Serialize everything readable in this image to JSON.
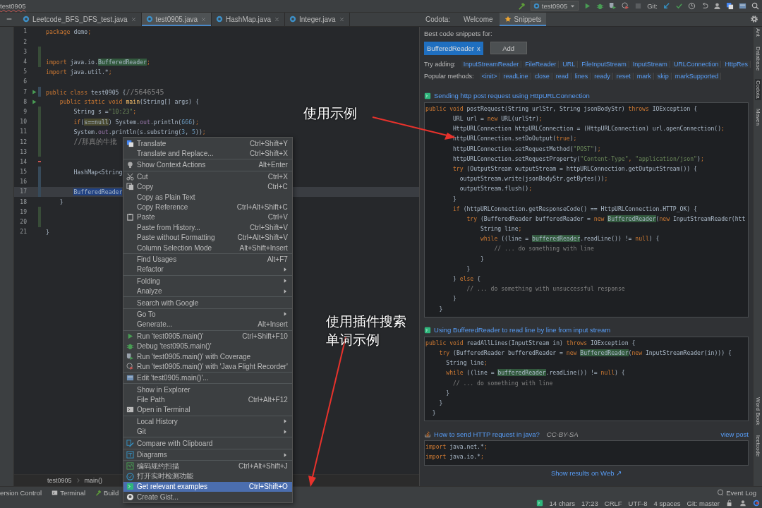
{
  "title_bar": {
    "breadcrumb": "test0905",
    "run_config": "test0905",
    "vcs_label": "Git:"
  },
  "editor_tabs": [
    {
      "label": "Leetcode_BFS_DFS_test.java",
      "selected": false
    },
    {
      "label": "test0905.java",
      "selected": true
    },
    {
      "label": "HashMap.java",
      "selected": false
    },
    {
      "label": "Integer.java",
      "selected": false
    }
  ],
  "tool_window": {
    "label": "Codota:",
    "tabs": [
      {
        "label": "Welcome",
        "selected": false
      },
      {
        "label": "Snippets",
        "selected": true
      }
    ]
  },
  "editor": {
    "lines": [
      {
        "number": "1",
        "kind": "plain",
        "runnable": false,
        "current": false,
        "segments": [
          {
            "text": "package",
            "kind": "keyword"
          },
          {
            "text": " demo",
            "kind": "plain"
          },
          {
            "text": ";",
            "kind": "keyword"
          }
        ]
      },
      {
        "number": "2",
        "kind": "plain",
        "runnable": false,
        "current": false
      },
      {
        "number": "3",
        "kind": "added",
        "runnable": false,
        "current": false
      },
      {
        "number": "4",
        "kind": "added",
        "runnable": false,
        "current": false,
        "segments": [
          {
            "text": "import",
            "kind": "keyword"
          },
          {
            "text": " java.io.",
            "kind": "plain"
          },
          {
            "text": "BufferedReader",
            "kind": "match"
          },
          {
            "text": ";",
            "kind": "keyword"
          }
        ]
      },
      {
        "number": "5",
        "kind": "plain",
        "runnable": false,
        "current": false,
        "segments": [
          {
            "text": "import",
            "kind": "keyword"
          },
          {
            "text": " java.util.*",
            "kind": "plain"
          },
          {
            "text": ";",
            "kind": "keyword"
          }
        ]
      },
      {
        "number": "6",
        "kind": "plain",
        "runnable": false,
        "current": false
      },
      {
        "number": "7",
        "kind": "modified",
        "runnable": true,
        "current": false,
        "segments": [
          {
            "text": "public class",
            "kind": "keyword"
          },
          {
            "text": " test0905 {",
            "kind": "plain"
          },
          {
            "text": "//5646545",
            "kind": "comment"
          }
        ]
      },
      {
        "number": "8",
        "kind": "plain",
        "runnable": true,
        "current": false,
        "segments": [
          {
            "text": "    public static void ",
            "kind": "keyword"
          },
          {
            "text": "main",
            "kind": "method"
          },
          {
            "text": "(String[] args) {",
            "kind": "plain"
          }
        ]
      },
      {
        "number": "9",
        "kind": "added",
        "runnable": false,
        "current": false,
        "segments": [
          {
            "text": "        String s =",
            "kind": "plain"
          },
          {
            "text": "\"10:23\"",
            "kind": "string"
          },
          {
            "text": ";",
            "kind": "keyword"
          }
        ]
      },
      {
        "number": "10",
        "kind": "added",
        "runnable": false,
        "current": false,
        "segments": [
          {
            "text": "        if",
            "kind": "keyword"
          },
          {
            "text": "(",
            "kind": "plain"
          },
          {
            "text": "s==null",
            "kind": "usage"
          },
          {
            "text": ") System.",
            "kind": "plain"
          },
          {
            "text": "out",
            "kind": "field"
          },
          {
            "text": ".println(",
            "kind": "plain"
          },
          {
            "text": "666",
            "kind": "number"
          },
          {
            "text": ")",
            "kind": "plain"
          },
          {
            "text": ";",
            "kind": "keyword"
          }
        ]
      },
      {
        "number": "11",
        "kind": "added",
        "runnable": false,
        "current": false,
        "segments": [
          {
            "text": "        System.",
            "kind": "plain"
          },
          {
            "text": "out",
            "kind": "field"
          },
          {
            "text": ".println(s.substring(",
            "kind": "plain"
          },
          {
            "text": "3",
            "kind": "number"
          },
          {
            "text": ", ",
            "kind": "plain"
          },
          {
            "text": "5",
            "kind": "number"
          },
          {
            "text": "))",
            "kind": "plain"
          },
          {
            "text": ";",
            "kind": "keyword"
          }
        ]
      },
      {
        "number": "12",
        "kind": "added",
        "runnable": false,
        "current": false,
        "segments": [
          {
            "text": "        //那真的牛批",
            "kind": "comment"
          }
        ]
      },
      {
        "number": "13",
        "kind": "added",
        "runnable": false,
        "current": false
      },
      {
        "number": "14",
        "kind": "deleted",
        "runnable": false,
        "current": false
      },
      {
        "number": "15",
        "kind": "modified",
        "runnable": false,
        "current": false,
        "segments": [
          {
            "text": "        HashMap<String",
            "kind": "plain"
          }
        ]
      },
      {
        "number": "16",
        "kind": "modified",
        "runnable": false,
        "current": false
      },
      {
        "number": "17",
        "kind": "modified",
        "runnable": false,
        "current": true,
        "segments": [
          {
            "text": "        BufferedReader",
            "kind": "selection"
          }
        ]
      },
      {
        "number": "18",
        "kind": "plain",
        "runnable": false,
        "current": false,
        "segments": [
          {
            "text": "    }",
            "kind": "plain"
          }
        ]
      },
      {
        "number": "19",
        "kind": "added",
        "runnable": false,
        "current": false
      },
      {
        "number": "20",
        "kind": "added",
        "runnable": false,
        "current": false
      },
      {
        "number": "21",
        "kind": "plain",
        "runnable": false,
        "current": false,
        "segments": [
          {
            "text": "}",
            "kind": "plain"
          }
        ]
      }
    ],
    "breadcrumb": [
      "test0905",
      "main()"
    ]
  },
  "context_menu": {
    "groups": [
      [
        {
          "label": "Translate",
          "shortcut": "Ctrl+Shift+Y",
          "submenu": false,
          "selected": false
        },
        {
          "label": "Translate and Replace...",
          "shortcut": "Ctrl+Shift+X",
          "submenu": false,
          "selected": false
        }
      ],
      [
        {
          "label": "Show Context Actions",
          "shortcut": "Alt+Enter",
          "submenu": false,
          "selected": false
        }
      ],
      [
        {
          "label": "Cut",
          "shortcut": "Ctrl+X",
          "submenu": false,
          "selected": false
        },
        {
          "label": "Copy",
          "shortcut": "Ctrl+C",
          "submenu": false,
          "selected": false
        },
        {
          "label": "Copy as Plain Text",
          "submenu": false,
          "selected": false
        },
        {
          "label": "Copy Reference",
          "shortcut": "Ctrl+Alt+Shift+C",
          "submenu": false,
          "selected": false
        },
        {
          "label": "Paste",
          "shortcut": "Ctrl+V",
          "submenu": false,
          "selected": false
        },
        {
          "label": "Paste from History...",
          "shortcut": "Ctrl+Shift+V",
          "submenu": false,
          "selected": false
        },
        {
          "label": "Paste without Formatting",
          "shortcut": "Ctrl+Alt+Shift+V",
          "submenu": false,
          "selected": false
        },
        {
          "label": "Column Selection Mode",
          "shortcut": "Alt+Shift+Insert",
          "submenu": false,
          "selected": false
        }
      ],
      [
        {
          "label": "Find Usages",
          "shortcut": "Alt+F7",
          "submenu": false,
          "selected": false
        },
        {
          "label": "Refactor",
          "submenu": true,
          "selected": false
        }
      ],
      [
        {
          "label": "Folding",
          "submenu": true,
          "selected": false
        },
        {
          "label": "Analyze",
          "submenu": true,
          "selected": false
        }
      ],
      [
        {
          "label": "Search with Google",
          "submenu": false,
          "selected": false
        }
      ],
      [
        {
          "label": "Go To",
          "submenu": true,
          "selected": false
        },
        {
          "label": "Generate...",
          "shortcut": "Alt+Insert",
          "submenu": false,
          "selected": false
        }
      ],
      [
        {
          "label": "Run 'test0905.main()'",
          "shortcut": "Ctrl+Shift+F10",
          "submenu": false,
          "selected": false
        },
        {
          "label": "Debug 'test0905.main()'",
          "submenu": false,
          "selected": false
        },
        {
          "label": "Run 'test0905.main()' with Coverage",
          "submenu": false,
          "selected": false
        },
        {
          "label": "Run 'test0905.main()' with 'Java Flight Recorder'",
          "submenu": false,
          "selected": false
        }
      ],
      [
        {
          "label": "Edit 'test0905.main()'...",
          "submenu": false,
          "selected": false
        }
      ],
      [
        {
          "label": "Show in Explorer",
          "submenu": false,
          "selected": false
        },
        {
          "label": "File Path",
          "shortcut": "Ctrl+Alt+F12",
          "submenu": false,
          "selected": false
        },
        {
          "label": "Open in Terminal",
          "submenu": false,
          "selected": false
        }
      ],
      [
        {
          "label": "Local History",
          "submenu": true,
          "selected": false
        },
        {
          "label": "Git",
          "submenu": true,
          "selected": false
        }
      ],
      [
        {
          "label": "Compare with Clipboard",
          "submenu": false,
          "selected": false
        }
      ],
      [
        {
          "label": "Diagrams",
          "submenu": true,
          "selected": false
        }
      ],
      [
        {
          "label": "编码规约扫描",
          "shortcut": "Ctrl+Alt+Shift+J",
          "submenu": false,
          "selected": false
        },
        {
          "label": "打开实时检测功能",
          "submenu": false,
          "selected": false
        },
        {
          "label": "Get relevant examples",
          "shortcut": "Ctrl+Shift+O",
          "submenu": false,
          "selected": true
        },
        {
          "label": "Create Gist...",
          "submenu": false,
          "selected": false
        }
      ]
    ]
  },
  "snippets_panel": {
    "heading": "Best code snippets for:",
    "query_chips": [
      {
        "label": "BufferedReader",
        "remove_mark": "x"
      }
    ],
    "add_button": "Add",
    "suggestions": [
      {
        "label": "Try adding:",
        "items": [
          "InputStreamReader",
          "FileReader",
          "URL",
          "FileInputStream",
          "InputStream",
          "URLConnection",
          "HttpRes"
        ]
      },
      {
        "label": "Popular methods:",
        "items": [
          "<init>",
          "readLine",
          "close",
          "read",
          "lines",
          "ready",
          "reset",
          "mark",
          "skip",
          "markSupported"
        ]
      }
    ],
    "results": [
      {
        "kind": "codota",
        "title": "Sending http post request using HttpURLConnection",
        "lines": [
          [
            {
              "text": "public void",
              "kind": "keyword"
            },
            {
              "text": " postRequest(String urlStr, String jsonBodyStr) ",
              "kind": "plain"
            },
            {
              "text": "throws",
              "kind": "keyword"
            },
            {
              "text": " IOException {",
              "kind": "plain"
            }
          ],
          [
            {
              "text": "        URL url = ",
              "kind": "plain"
            },
            {
              "text": "new",
              "kind": "keyword"
            },
            {
              "text": " URL(urlStr)",
              "kind": "plain"
            },
            {
              "text": ";",
              "kind": "keyword"
            }
          ],
          [
            {
              "text": "        HttpURLConnection httpURLConnection = (HttpURLConnection) url.openConnection()",
              "kind": "plain"
            },
            {
              "text": ";",
              "kind": "keyword"
            }
          ],
          [
            {
              "text": "        httpURLConnection.setDoOutput(",
              "kind": "plain"
            },
            {
              "text": "true",
              "kind": "keyword"
            },
            {
              "text": ")",
              "kind": "plain"
            },
            {
              "text": ";",
              "kind": "keyword"
            }
          ],
          [
            {
              "text": "        httpURLConnection.setRequestMethod(",
              "kind": "plain"
            },
            {
              "text": "\"POST\"",
              "kind": "string"
            },
            {
              "text": ")",
              "kind": "plain"
            },
            {
              "text": ";",
              "kind": "keyword"
            }
          ],
          [
            {
              "text": "        httpURLConnection.setRequestProperty(",
              "kind": "plain"
            },
            {
              "text": "\"Content-Type\"",
              "kind": "string"
            },
            {
              "text": ", ",
              "kind": "keyword"
            },
            {
              "text": "\"application/json\"",
              "kind": "string"
            },
            {
              "text": ")",
              "kind": "plain"
            },
            {
              "text": ";",
              "kind": "keyword"
            }
          ],
          [
            {
              "text": "        try",
              "kind": "keyword"
            },
            {
              "text": " (OutputStream outputStream = httpURLConnection.getOutputStream()) {",
              "kind": "plain"
            }
          ],
          [
            {
              "text": "          outputStream.write(jsonBodyStr.getBytes())",
              "kind": "plain"
            },
            {
              "text": ";",
              "kind": "keyword"
            }
          ],
          [
            {
              "text": "          outputStream.flush()",
              "kind": "plain"
            },
            {
              "text": ";",
              "kind": "keyword"
            }
          ],
          [
            {
              "text": "        }",
              "kind": "plain"
            }
          ],
          [
            {
              "text": "        if",
              "kind": "keyword"
            },
            {
              "text": " (httpURLConnection.getResponseCode() == HttpURLConnection.HTTP_OK) {",
              "kind": "plain"
            }
          ],
          [
            {
              "text": "            try",
              "kind": "keyword"
            },
            {
              "text": " (BufferedReader bufferedReader = ",
              "kind": "plain"
            },
            {
              "text": "new",
              "kind": "keyword"
            },
            {
              "text": " BufferedReader",
              "kind": "match"
            },
            {
              "text": "(",
              "kind": "plain"
            },
            {
              "text": "new",
              "kind": "keyword"
            },
            {
              "text": " InputStreamReader(htt",
              "kind": "plain"
            }
          ],
          [
            {
              "text": "                String line",
              "kind": "plain"
            },
            {
              "text": ";",
              "kind": "keyword"
            }
          ],
          [
            {
              "text": "                while",
              "kind": "keyword"
            },
            {
              "text": " ((line = ",
              "kind": "plain"
            },
            {
              "text": "bufferedReader",
              "kind": "match"
            },
            {
              "text": ".readLine()) != ",
              "kind": "plain"
            },
            {
              "text": "null",
              "kind": "keyword"
            },
            {
              "text": ") {",
              "kind": "plain"
            }
          ],
          [
            {
              "text": "                    // ... do something with line",
              "kind": "comment"
            }
          ],
          [
            {
              "text": "                }",
              "kind": "plain"
            }
          ],
          [
            {
              "text": "            }",
              "kind": "plain"
            }
          ],
          [
            {
              "text": "        } ",
              "kind": "plain"
            },
            {
              "text": "else",
              "kind": "keyword"
            },
            {
              "text": " {",
              "kind": "plain"
            }
          ],
          [
            {
              "text": "            // ... do something with unsuccessful response",
              "kind": "comment"
            }
          ],
          [
            {
              "text": "        }",
              "kind": "plain"
            }
          ],
          [
            {
              "text": "    }",
              "kind": "plain"
            }
          ]
        ]
      },
      {
        "kind": "codota",
        "title": "Using BufferedReader to read line by line from input stream",
        "lines": [
          [
            {
              "text": "public void",
              "kind": "keyword"
            },
            {
              "text": " readAllLines(InputStream in) ",
              "kind": "plain"
            },
            {
              "text": "throws",
              "kind": "keyword"
            },
            {
              "text": " IOException {",
              "kind": "plain"
            }
          ],
          [
            {
              "text": "    try",
              "kind": "keyword"
            },
            {
              "text": " (BufferedReader bufferedReader = ",
              "kind": "plain"
            },
            {
              "text": "new",
              "kind": "keyword"
            },
            {
              "text": " BufferedReader",
              "kind": "match"
            },
            {
              "text": "(",
              "kind": "plain"
            },
            {
              "text": "new",
              "kind": "keyword"
            },
            {
              "text": " InputStreamReader(in))) {",
              "kind": "plain"
            }
          ],
          [
            {
              "text": "      String line",
              "kind": "plain"
            },
            {
              "text": ";",
              "kind": "keyword"
            }
          ],
          [
            {
              "text": "      while",
              "kind": "keyword"
            },
            {
              "text": " ((line = ",
              "kind": "plain"
            },
            {
              "text": "bufferedReader",
              "kind": "match"
            },
            {
              "text": ".readLine()) != ",
              "kind": "plain"
            },
            {
              "text": "null",
              "kind": "keyword"
            },
            {
              "text": ") {",
              "kind": "plain"
            }
          ],
          [
            {
              "text": "        // ... do something with line",
              "kind": "comment"
            }
          ],
          [
            {
              "text": "      }",
              "kind": "plain"
            }
          ],
          [
            {
              "text": "    }",
              "kind": "plain"
            }
          ],
          [
            {
              "text": "  }",
              "kind": "plain"
            }
          ]
        ]
      },
      {
        "kind": "stackoverflow",
        "title": "How to send HTTP request in java?",
        "license": "CC-BY-SA",
        "link": "view post",
        "lines": [
          [
            {
              "text": "import",
              "kind": "keyword"
            },
            {
              "text": " java.net.*",
              "kind": "plain"
            },
            {
              "text": ";",
              "kind": "keyword"
            }
          ],
          [
            {
              "text": "import",
              "kind": "keyword"
            },
            {
              "text": " java.io.*",
              "kind": "plain"
            },
            {
              "text": ";",
              "kind": "keyword"
            }
          ]
        ]
      }
    ],
    "footer_link": "Show results on Web ↗"
  },
  "right_strip": {
    "top": [
      {
        "label": "Ant",
        "selected": false
      },
      {
        "label": "Database",
        "selected": false
      },
      {
        "label": "Codota",
        "selected": true
      },
      {
        "label": "Maven",
        "selected": false
      }
    ],
    "bottom": [
      {
        "label": "Word Book",
        "selected": false
      },
      {
        "label": "leetcode",
        "selected": false
      }
    ]
  },
  "tool_windows": [
    "ersion Control",
    "Terminal",
    "Build"
  ],
  "event_log": "Event Log",
  "status_bar": [
    "14 chars",
    "17:23",
    "CRLF",
    "UTF-8",
    "4 spaces",
    "Git: master"
  ],
  "annotations": [
    {
      "text": "使用示例"
    },
    {
      "text": "使用插件搜索单词示例"
    }
  ]
}
